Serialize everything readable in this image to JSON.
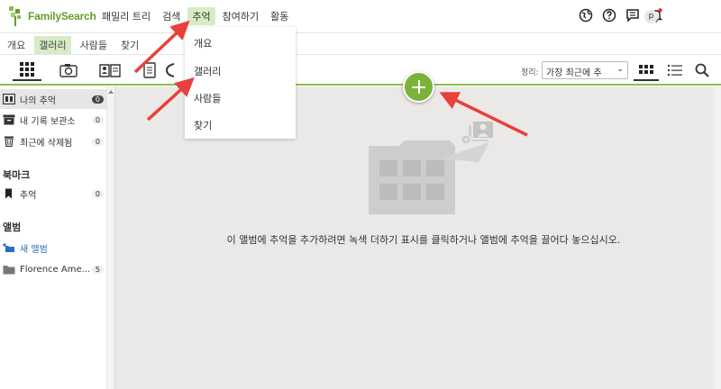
{
  "logo": {
    "text": "FamilySearch"
  },
  "nav": [
    {
      "label": "패밀리 트리"
    },
    {
      "label": "검색"
    },
    {
      "label": "추억"
    },
    {
      "label": "참여하기"
    },
    {
      "label": "활동"
    }
  ],
  "user": {
    "initial": "p"
  },
  "subnav": [
    {
      "label": "개요"
    },
    {
      "label": "갤러리"
    },
    {
      "label": "사람들"
    },
    {
      "label": "찾기"
    }
  ],
  "toolbar": {
    "sort_label": "정리:",
    "sort_value": "가장 최근에 추"
  },
  "sidebar": {
    "items": [
      {
        "label": "나의 추억",
        "count": "0"
      },
      {
        "label": "내 기록 보관소",
        "count": "0"
      },
      {
        "label": "최근에 삭제됨",
        "count": "0"
      }
    ],
    "bookmarks_heading": "북마크",
    "bookmarks": [
      {
        "label": "추억",
        "count": "0"
      }
    ],
    "albums_heading": "앨범",
    "new_album": "새 앨범",
    "albums": [
      {
        "label": "Florence Ame...",
        "count": "5"
      }
    ]
  },
  "main": {
    "empty_message": "이 앨범에 추억을 추가하려면 녹색 더하기 표시를 클릭하거나 앨범에 추억을 끌어다 놓으십시오."
  },
  "dropdown": [
    {
      "label": "개요"
    },
    {
      "label": "갤러리"
    },
    {
      "label": "사람들"
    },
    {
      "label": "찾기"
    }
  ],
  "colors": {
    "accent_green": "#7bb33a",
    "annotation_red": "#e8403a",
    "main_bg": "#ebe9e7"
  }
}
